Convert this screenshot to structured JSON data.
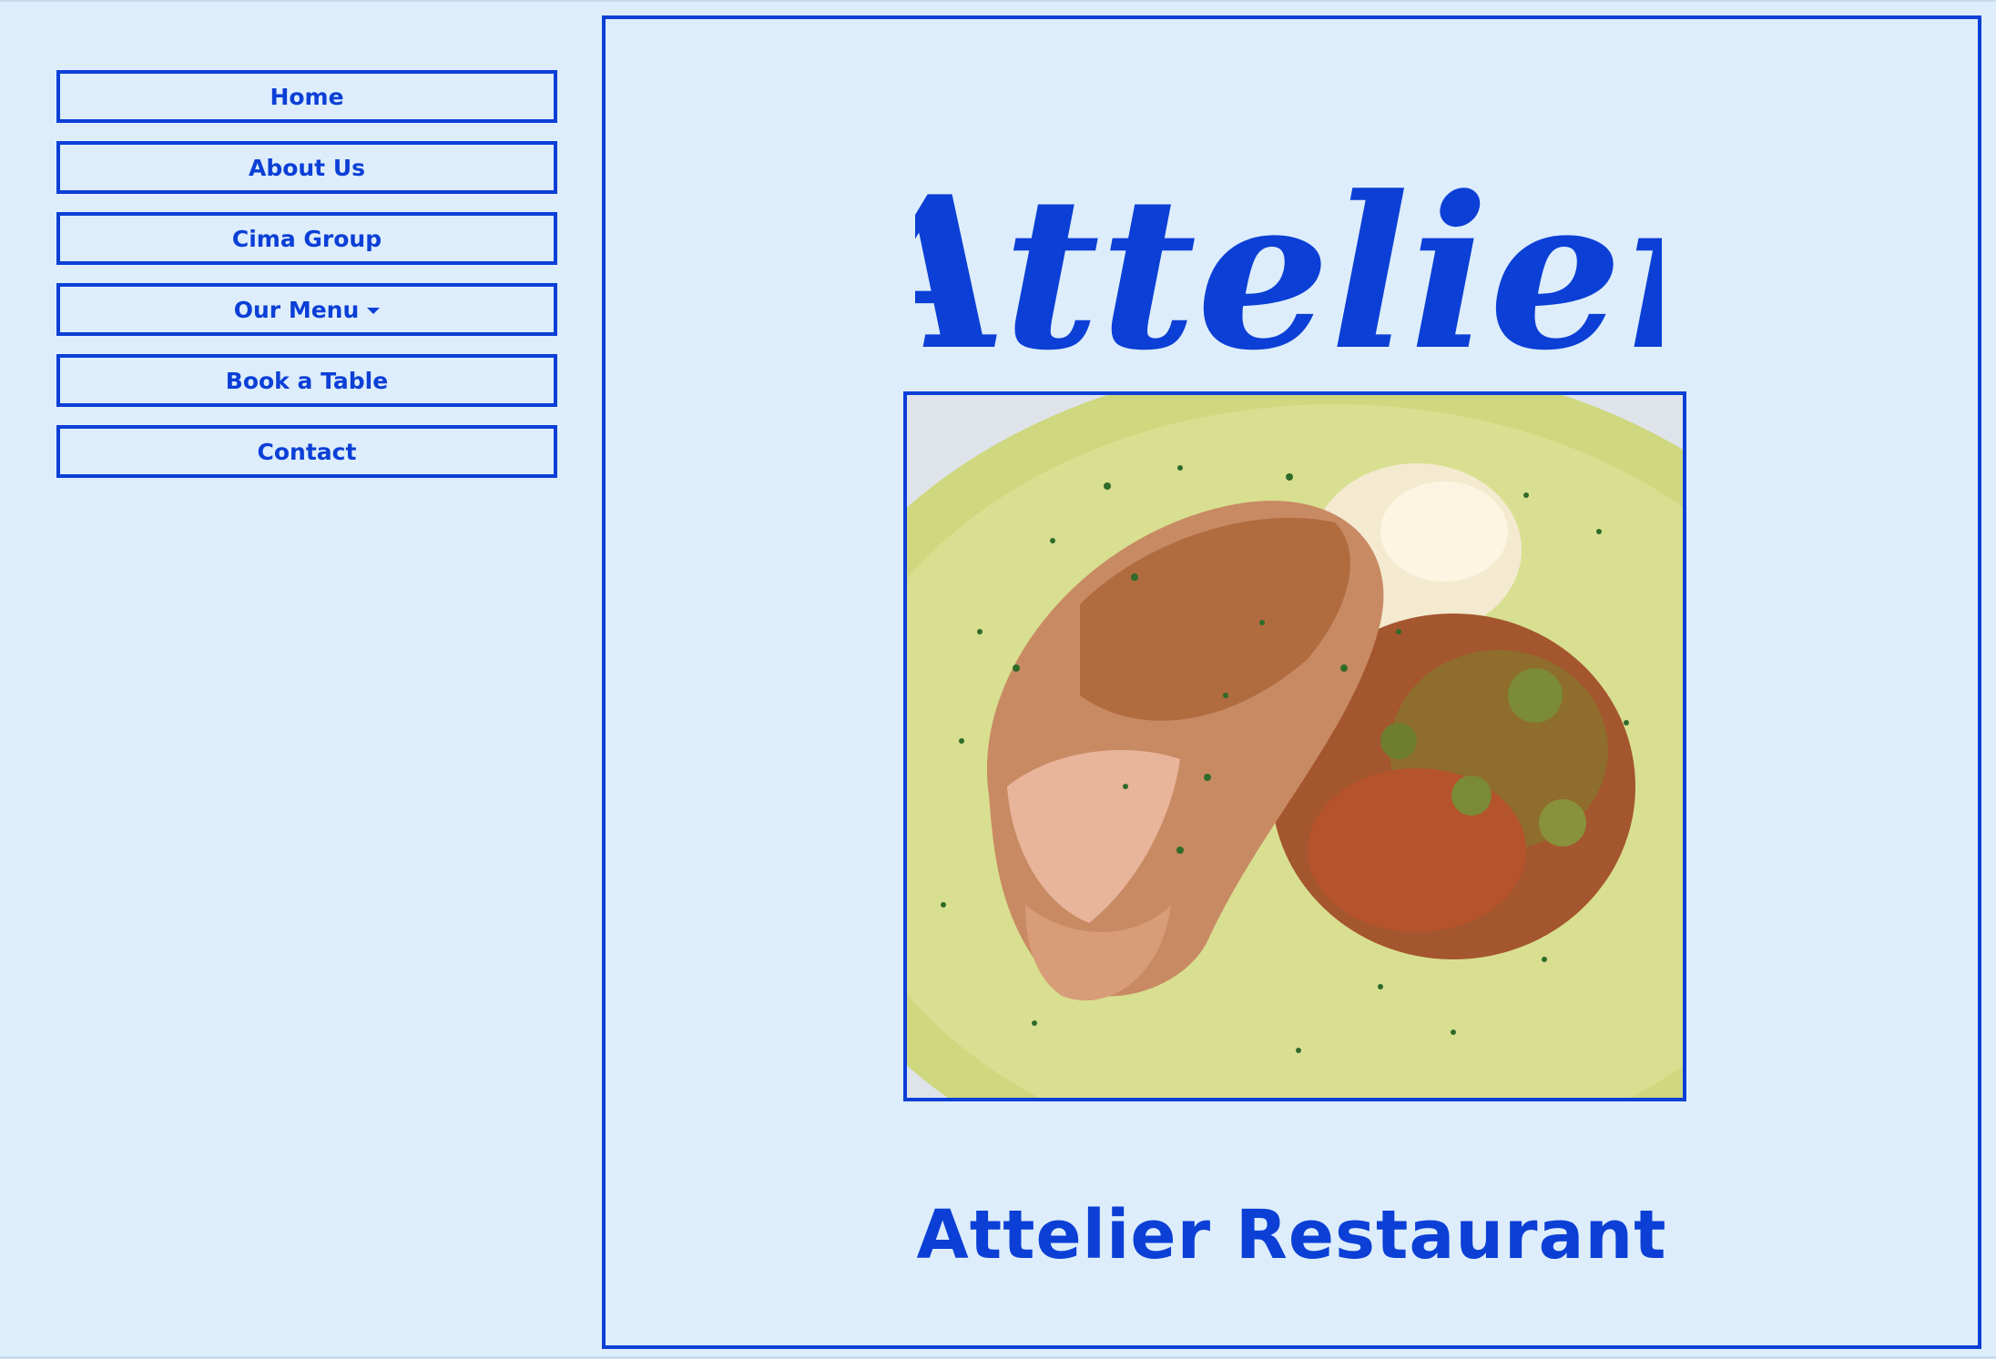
{
  "nav": {
    "items": [
      {
        "label": "Home"
      },
      {
        "label": "About Us"
      },
      {
        "label": "Cima Group"
      },
      {
        "label": "Our Menu",
        "has_dropdown": true
      },
      {
        "label": "Book a Table"
      },
      {
        "label": "Contact"
      }
    ]
  },
  "hero": {
    "logo_text": "Attelier",
    "image_description": "grilled chicken with mashed potatoes and stewed vegetables",
    "title": "Attelier Restaurant"
  },
  "colors": {
    "background": "#ddedfb",
    "accent": "#0b3fd6"
  },
  "icons": {
    "dropdown": "caret-down-icon"
  }
}
